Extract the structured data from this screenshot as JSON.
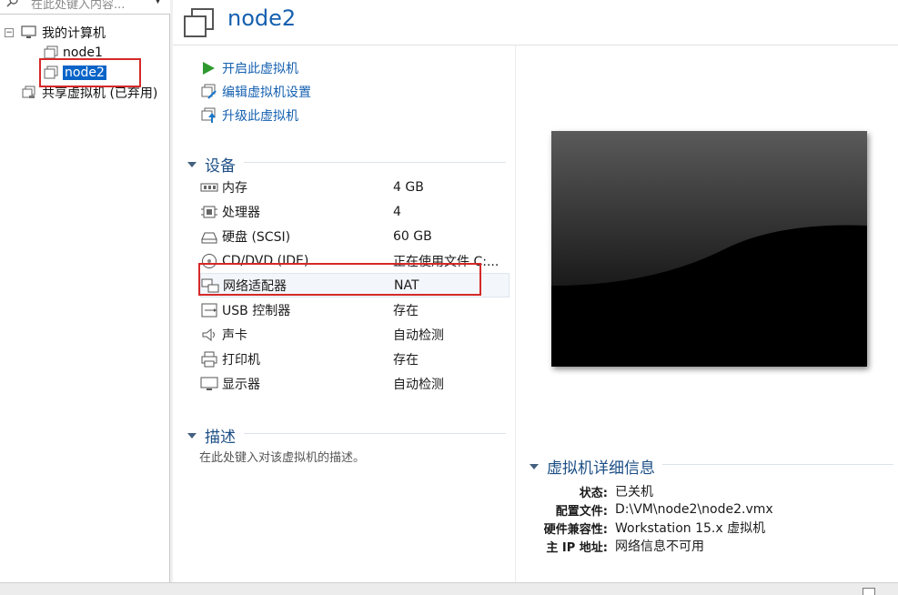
{
  "library": {
    "search_placeholder": "在此处键入内容...",
    "my_computer": "我的计算机",
    "vms": [
      "node1",
      "node2"
    ],
    "shared": "共享虚拟机 (已弃用)"
  },
  "vm": {
    "title": "node2",
    "actions": {
      "start": "开启此虚拟机",
      "edit": "编辑虚拟机设置",
      "upgrade": "升级此虚拟机"
    },
    "devices_header": "设备",
    "devices": [
      {
        "name": "内存",
        "value": "4 GB",
        "icon": "memory-icon"
      },
      {
        "name": "处理器",
        "value": "4",
        "icon": "cpu-icon"
      },
      {
        "name": "硬盘 (SCSI)",
        "value": "60 GB",
        "icon": "harddisk-icon"
      },
      {
        "name": "CD/DVD (IDE)",
        "value": "正在使用文件 C:...",
        "icon": "cd-icon"
      },
      {
        "name": "网络适配器",
        "value": "NAT",
        "icon": "network-icon"
      },
      {
        "name": "USB 控制器",
        "value": "存在",
        "icon": "usb-icon"
      },
      {
        "name": "声卡",
        "value": "自动检测",
        "icon": "sound-icon"
      },
      {
        "name": "打印机",
        "value": "存在",
        "icon": "printer-icon"
      },
      {
        "name": "显示器",
        "value": "自动检测",
        "icon": "display-icon"
      }
    ],
    "description_header": "描述",
    "description_placeholder": "在此处键入对该虚拟机的描述。",
    "details_header": "虚拟机详细信息",
    "details": [
      {
        "key": "状态:",
        "value": "已关机"
      },
      {
        "key": "配置文件:",
        "value": "D:\\VM\\node2\\node2.vmx"
      },
      {
        "key": "硬件兼容性:",
        "value": "Workstation 15.x 虚拟机"
      },
      {
        "key": "主 IP 地址:",
        "value": "网络信息不可用"
      }
    ]
  },
  "colors": {
    "accent": "#1560b0",
    "selection": "#0a64c8",
    "highlight_box": "#d62828"
  }
}
